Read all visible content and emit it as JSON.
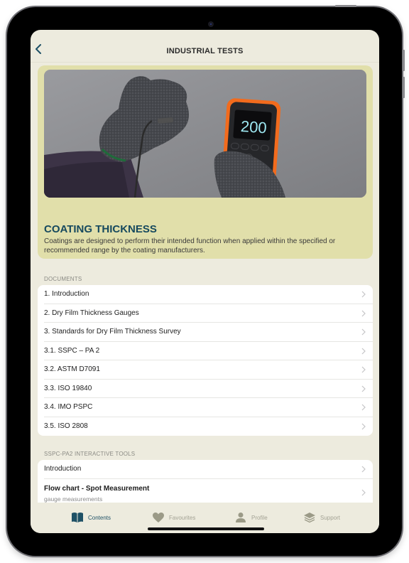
{
  "header": {
    "title": "INDUSTRIAL TESTS",
    "back_icon": "chevron-left-icon"
  },
  "hero": {
    "image_description": "gloved hand pressing probe against grey wall while other hand holds orange coating thickness gauge",
    "gauge_reading": "200",
    "title": "COATING THICKNESS",
    "description": "Coatings are designed to perform their intended function when applied within the specified or recommended range by the coating manufacturers."
  },
  "documents": {
    "label": "DOCUMENTS",
    "items": [
      {
        "label": "1. Introduction"
      },
      {
        "label": "2. Dry Film Thickness Gauges"
      },
      {
        "label": "3. Standards for Dry Film Thickness Survey"
      },
      {
        "label": "3.1. SSPC – PA 2"
      },
      {
        "label": "3.2. ASTM D7091"
      },
      {
        "label": "3.3. ISO 19840"
      },
      {
        "label": "3.4. IMO PSPC"
      },
      {
        "label": "3.5. ISO 2808"
      }
    ]
  },
  "tools": {
    "label": "SSPC-PA2 INTERACTIVE TOOLS",
    "items": [
      {
        "label": "Introduction"
      },
      {
        "label": "Flow chart - Spot Measurement",
        "subtitle": "gauge measurements"
      }
    ]
  },
  "tabbar": {
    "items": [
      {
        "label": "Contents",
        "icon": "book-icon",
        "active": true
      },
      {
        "label": "Favourites",
        "icon": "heart-icon",
        "active": false
      },
      {
        "label": "Profile",
        "icon": "person-icon",
        "active": false
      },
      {
        "label": "Support",
        "icon": "layers-icon",
        "active": false
      }
    ]
  },
  "colors": {
    "accent": "#1f5166",
    "background": "#edebde",
    "hero_card": "#e1dfaa",
    "inactive_tab": "#a3a294",
    "gauge_orange": "#f26b1d"
  }
}
